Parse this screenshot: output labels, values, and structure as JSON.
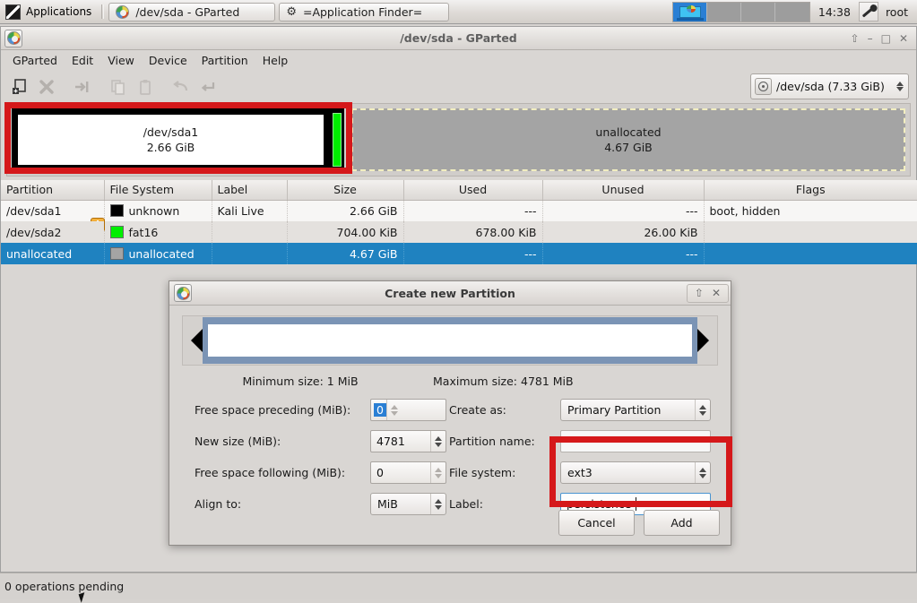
{
  "taskbar": {
    "applications_label": "Applications",
    "tasks": [
      {
        "label": "/dev/sda - GParted",
        "icon": "gparted-icon"
      },
      {
        "label": "=Application Finder=",
        "icon": "gear-icon"
      }
    ],
    "clock": "14:38",
    "user": "root",
    "workspace_count": 4,
    "active_workspace": 1
  },
  "window": {
    "title": "/dev/sda - GParted",
    "menus": [
      "GParted",
      "Edit",
      "View",
      "Device",
      "Partition",
      "Help"
    ],
    "toolbar": [
      {
        "name": "new-partition-button",
        "icon": "new-document-icon"
      },
      {
        "name": "delete-partition-button",
        "icon": "delete-x-icon"
      },
      {
        "name": "resize-move-button",
        "icon": "resize-move-icon"
      },
      {
        "name": "copy-button",
        "icon": "copy-icon"
      },
      {
        "name": "paste-button",
        "icon": "paste-icon"
      },
      {
        "name": "undo-button",
        "icon": "undo-arrow-icon"
      },
      {
        "name": "apply-button",
        "icon": "apply-check-icon"
      }
    ],
    "device_selector": "/dev/sda  (7.33 GiB)"
  },
  "graphic": {
    "sda1": {
      "name": "/dev/sda1",
      "size": "2.66 GiB",
      "color": "#ffffff"
    },
    "sda2": {
      "name": "/dev/sda2",
      "color": "#00ef00"
    },
    "unallocated": {
      "name": "unallocated",
      "size": "4.67 GiB",
      "color": "#a4a4a4"
    }
  },
  "table": {
    "headers": [
      "Partition",
      "File System",
      "Label",
      "Size",
      "Used",
      "Unused",
      "Flags"
    ],
    "rows": [
      {
        "partition": "/dev/sda1",
        "filesystem": "unknown",
        "fs_color": "#000000",
        "label": "Kali Live",
        "size": "2.66 GiB",
        "used": "---",
        "unused": "---",
        "flags": "boot, hidden",
        "warning_icon": "warning-icon",
        "selected": false
      },
      {
        "partition": "/dev/sda2",
        "filesystem": "fat16",
        "fs_color": "#00ef00",
        "label": "",
        "size": "704.00 KiB",
        "used": "678.00 KiB",
        "unused": "26.00 KiB",
        "flags": "",
        "warning_icon": "",
        "selected": false
      },
      {
        "partition": "unallocated",
        "filesystem": "unallocated",
        "fs_color": "#a4a4a4",
        "label": "",
        "size": "4.67 GiB",
        "used": "---",
        "unused": "---",
        "flags": "",
        "warning_icon": "",
        "selected": true
      }
    ]
  },
  "dialog": {
    "title": "Create new Partition",
    "minimum_size": "Minimum size: 1 MiB",
    "maximum_size": "Maximum size: 4781 MiB",
    "fields": {
      "free_preceding_label": "Free space preceding (MiB):",
      "free_preceding_value": "0",
      "new_size_label": "New size (MiB):",
      "new_size_value": "4781",
      "free_following_label": "Free space following (MiB):",
      "free_following_value": "0",
      "align_label": "Align to:",
      "align_value": "MiB",
      "create_as_label": "Create as:",
      "create_as_value": "Primary Partition",
      "partition_name_label": "Partition name:",
      "partition_name_value": "",
      "file_system_label": "File system:",
      "file_system_value": "ext3",
      "label_label": "Label:",
      "label_value": "persistence"
    },
    "cancel_label": "Cancel",
    "add_label": "Add"
  },
  "statusbar": {
    "text": "0 operations pending"
  },
  "annotations": {
    "highlight_color": "#d5181a"
  }
}
